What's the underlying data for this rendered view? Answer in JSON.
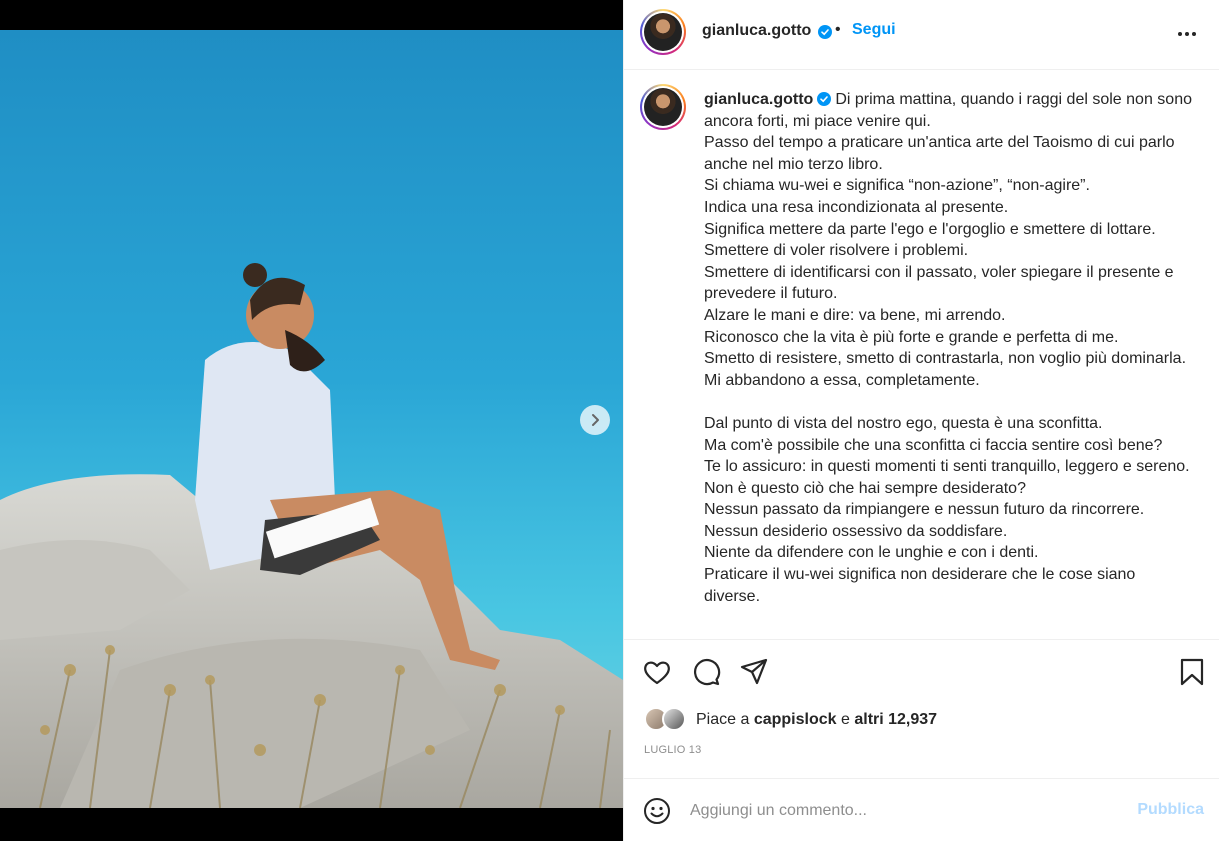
{
  "post": {
    "username": "gianluca.gotto",
    "follow_label": "Segui",
    "separator": "•",
    "caption_lines_1": [
      "Di prima mattina, quando i raggi del sole non sono ancora forti, mi piace venire qui.",
      "Passo del tempo a praticare un'antica arte del Taoismo di cui parlo anche nel mio terzo libro.",
      "Si chiama wu-wei e significa “non-azione”, “non-agire”.",
      "Indica una resa incondizionata al presente.",
      "Significa mettere da parte l'ego e l'orgoglio e smettere di lottare.",
      "Smettere di voler risolvere i problemi.",
      "Smettere di identificarsi con il passato, voler spiegare il presente e prevedere il futuro.",
      "Alzare le mani e dire: va bene, mi arrendo.",
      "Riconosco che la vita è più forte e grande e perfetta di me.",
      "Smetto di resistere, smetto di contrastarla, non voglio più dominarla.",
      "Mi abbandono a essa, completamente."
    ],
    "caption_lines_2": [
      "Dal punto di vista del nostro ego, questa è una sconfitta.",
      "Ma com'è possibile che una sconfitta ci faccia sentire così bene?",
      "Te lo assicuro: in questi momenti ti senti tranquillo, leggero e sereno.",
      "Non è questo ciò che hai sempre desiderato?",
      "Nessun passato da rimpiangere e nessun futuro da rincorrere.",
      "Nessun desiderio ossessivo da soddisfare.",
      "Niente da difendere con le unghie e con i denti.",
      "Praticare il wu-wei significa non desiderare che le cose siano diverse."
    ],
    "likes": {
      "prefix": "Piace a",
      "user": "cappislock",
      "conj": "e",
      "others": "altri 12,937"
    },
    "date": "LUGLIO 13"
  },
  "comment": {
    "placeholder": "Aggiungi un commento...",
    "publish_label": "Pubblica"
  },
  "icons": {
    "like": "heart-icon",
    "comment": "comment-icon",
    "share": "share-icon",
    "save": "bookmark-icon",
    "emoji": "emoji-icon",
    "more": "more-options-icon",
    "next": "chevron-right-icon",
    "verified": "verified-badge-icon"
  },
  "colors": {
    "accent": "#0095f6",
    "publish_disabled": "#b3dbff",
    "text": "#262626",
    "muted": "#8e8e8e"
  }
}
